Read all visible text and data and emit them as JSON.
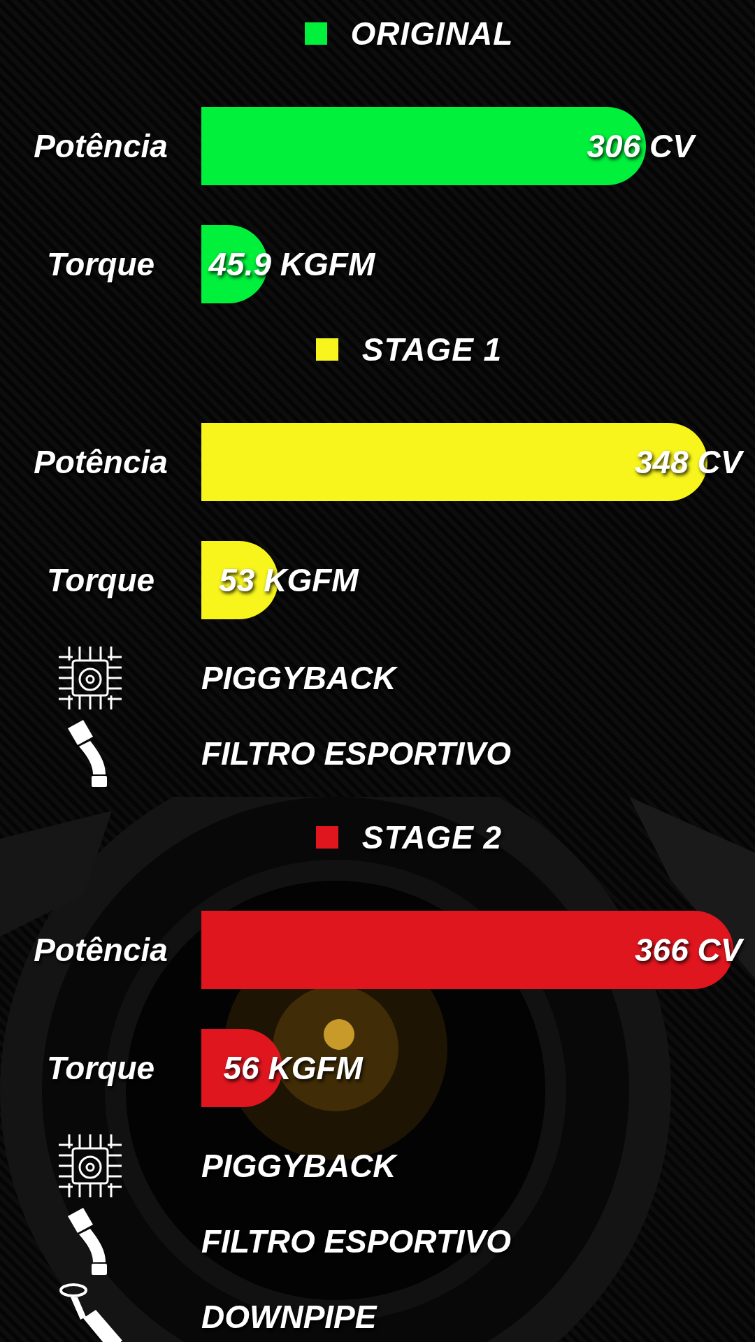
{
  "sections": [
    {
      "title": "ORIGINAL",
      "color": "#00f03c",
      "bars": [
        {
          "label": "Potência",
          "value": "306 CV"
        },
        {
          "label": "Torque",
          "value": "45.9 KGFM"
        }
      ]
    },
    {
      "title": "STAGE 1",
      "color": "#f8f51c",
      "bars": [
        {
          "label": "Potência",
          "value": "348 CV"
        },
        {
          "label": "Torque",
          "value": "53 KGFM"
        }
      ],
      "items": [
        {
          "kind": "chip",
          "label": "PIGGYBACK"
        },
        {
          "kind": "filter",
          "label": "FILTRO ESPORTIVO"
        }
      ]
    },
    {
      "title": "STAGE 2",
      "color": "#e0161f",
      "bars": [
        {
          "label": "Potência",
          "value": "366 CV"
        },
        {
          "label": "Torque",
          "value": "56 KGFM"
        }
      ],
      "items": [
        {
          "kind": "chip",
          "label": "PIGGYBACK"
        },
        {
          "kind": "filter",
          "label": "FILTRO ESPORTIVO"
        },
        {
          "kind": "downpipe",
          "label": "DOWNPIPE"
        }
      ]
    }
  ]
}
